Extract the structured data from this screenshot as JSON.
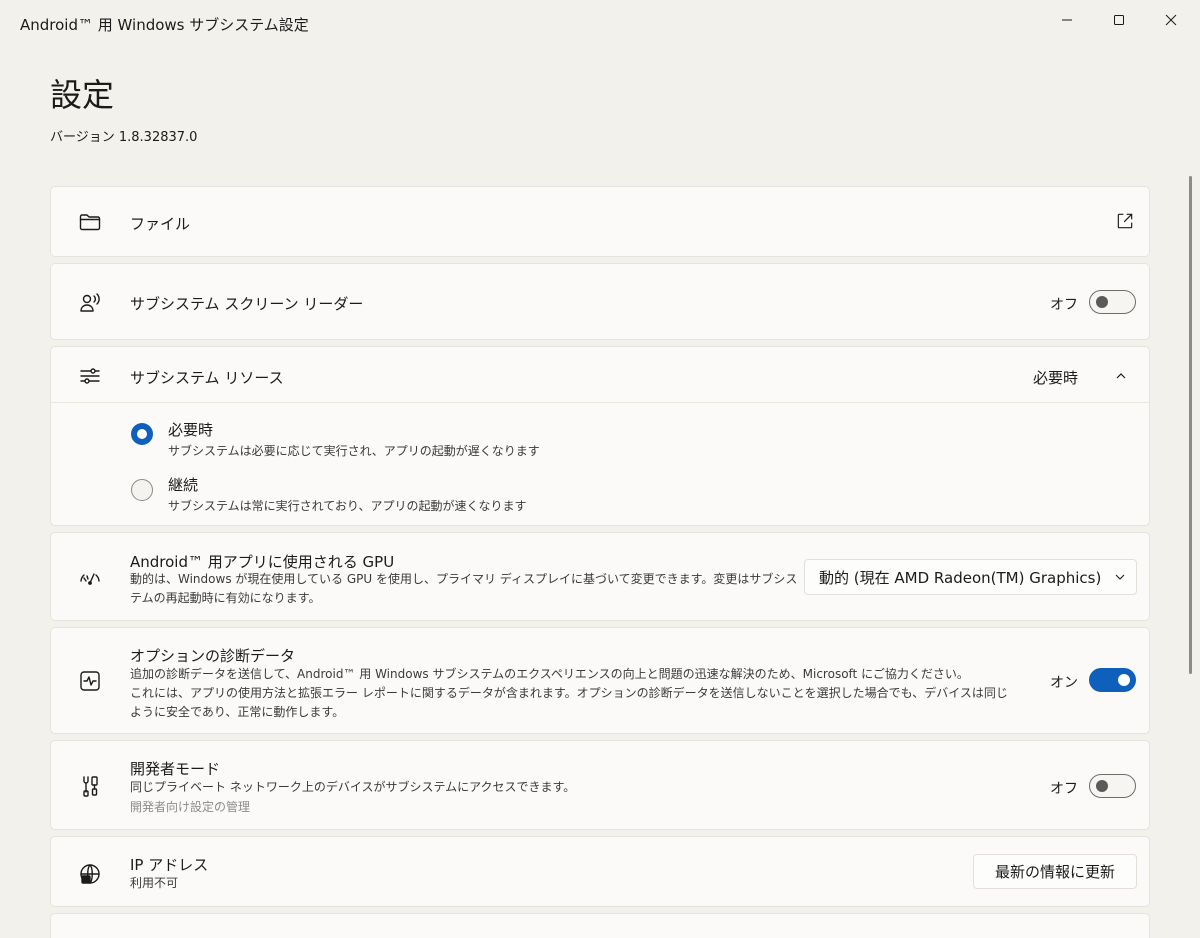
{
  "window": {
    "title": "Android™ 用 Windows サブシステム設定",
    "minimize_icon": "minimize-icon",
    "maximize_icon": "maximize-icon",
    "close_icon": "close-icon"
  },
  "page": {
    "title": "設定",
    "version": "バージョン 1.8.32837.0"
  },
  "files": {
    "label": "ファイル",
    "icon": "folder-icon",
    "action_icon": "open-external-icon"
  },
  "screen_reader": {
    "label": "サブシステム スクリーン リーダー",
    "icon": "screen-reader-icon",
    "state_text": "オフ",
    "on": false
  },
  "resources": {
    "label": "サブシステム リソース",
    "icon": "sliders-icon",
    "selected_value": "必要時",
    "options": [
      {
        "label": "必要時",
        "desc": "サブシステムは必要に応じて実行され、アプリの起動が遅くなります",
        "checked": true
      },
      {
        "label": "継続",
        "desc": "サブシステムは常に実行されており、アプリの起動が速くなります",
        "checked": false
      }
    ]
  },
  "gpu": {
    "label": "Android™ 用アプリに使用される GPU",
    "desc_line1": "動的は、Windows が現在使用している GPU を使用し、プライマリ ディスプレイに基づいて変更できます。変更はサブシス",
    "desc_line2": "テムの再起動時に有効になります。",
    "selected": "動的 (現在 AMD Radeon(TM) Graphics)",
    "icon": "gauge-icon"
  },
  "diagnostics": {
    "label": "オプションの診断データ",
    "desc_line1": "追加の診断データを送信して、Android™ 用 Windows サブシステムのエクスペリエンスの向上と問題の迅速な解決のため、Microsoft にご協力ください。",
    "desc_line2": "これには、アプリの使用方法と拡張エラー レポートに関するデータが含まれます。オプションの診断データを送信しないことを選択した場合でも、デバイスは同じ",
    "desc_line3": "ように安全であり、正常に動作します。",
    "state_text": "オン",
    "on": true,
    "icon": "pulse-icon"
  },
  "developer": {
    "label": "開発者モード",
    "desc": "同じプライベート ネットワーク上のデバイスがサブシステムにアクセスできます。",
    "link": "開発者向け設定の管理",
    "state_text": "オフ",
    "on": false,
    "icon": "tools-icon"
  },
  "ip": {
    "label": "IP アドレス",
    "value": "利用不可",
    "button": "最新の情報に更新",
    "icon": "globe-icon"
  },
  "colors": {
    "accent": "#0f5fbd",
    "background": "#f3f1ec",
    "card": "#fbfaf8"
  }
}
